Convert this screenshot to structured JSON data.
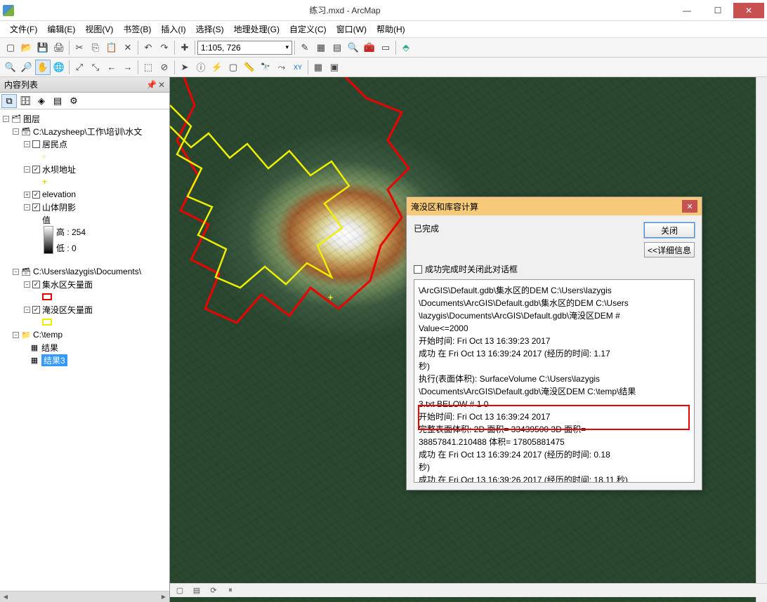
{
  "window": {
    "title": "练习.mxd - ArcMap"
  },
  "menu": {
    "file": "文件(F)",
    "edit": "编辑(E)",
    "view": "视图(V)",
    "bookmarks": "书签(B)",
    "insert": "插入(I)",
    "selection": "选择(S)",
    "geoprocessing": "地理处理(G)",
    "customize": "自定义(C)",
    "windows": "窗口(W)",
    "help": "帮助(H)"
  },
  "scale": "1:105, 726",
  "toc": {
    "title": "内容列表",
    "root": "图层",
    "dataframe1": "C:\\Lazysheep\\工作\\培训\\水文",
    "layer_settlement": "居民点",
    "layer_dam": "水坝地址",
    "layer_elev": "elevation",
    "layer_hillshade": "山体阴影",
    "hs_value": "值",
    "hs_high": "高 : 254",
    "hs_low": "低 : 0",
    "dataframe2": "C:\\Users\\lazygis\\Documents\\",
    "layer_catch": "集水区矢量面",
    "layer_flood": "淹没区矢量面",
    "folder_temp": "C:\\temp",
    "table_result": "结果",
    "table_result3": "结果3"
  },
  "dialog": {
    "title": "淹没区和库容计算",
    "status": "已完成",
    "btn_close": "关闭",
    "btn_details": "<<详细信息",
    "chk_label": "成功完成时关闭此对话框",
    "log_l1": "\\ArcGIS\\Default.gdb\\集水区的DEM C:\\Users\\lazygis",
    "log_l2": "\\Documents\\ArcGIS\\Default.gdb\\集水区的DEM C:\\Users",
    "log_l3": "\\lazygis\\Documents\\ArcGIS\\Default.gdb\\淹没区DEM #",
    "log_l4": "Value<=2000",
    "log_l5": "开始时间: Fri Oct 13 16:39:23 2017",
    "log_l6": "成功 在 Fri Oct 13 16:39:24 2017 (经历的时间: 1.17",
    "log_l7": "秒)",
    "log_l8": "执行(表面体积): SurfaceVolume C:\\Users\\lazygis",
    "log_l9": "\\Documents\\ArcGIS\\Default.gdb\\淹没区DEM C:\\temp\\结果",
    "log_l10": "3.txt BELOW # 1 0",
    "log_l11": "开始时间: Fri Oct 13 16:39:24 2017",
    "log_l12": "完整表面体积: 2D 面积=      33439500  3D 面积=",
    "log_l13": "38857841.210488   体积=    17805881475",
    "log_l14": "成功 在 Fri Oct 13 16:39:24 2017 (经历的时间: 0.18",
    "log_l15": "秒)",
    "log_l16": "成功 在 Fri Oct 13 16:39:26 2017 (经历的时间: 18.11 秒)"
  }
}
